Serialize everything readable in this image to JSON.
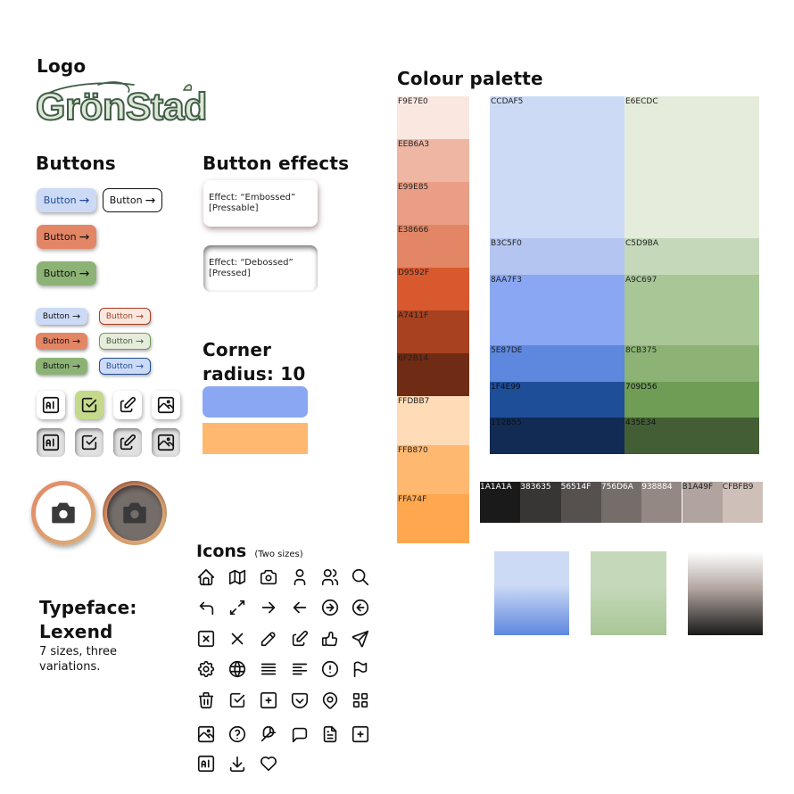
{
  "logo": {
    "heading": "Logo",
    "wordmark": "GrönStad"
  },
  "buttons": {
    "heading": "Buttons",
    "label": "Button",
    "arrow": "→"
  },
  "button_effects": {
    "heading": "Button effects",
    "embossed": {
      "line1": "Effect: “Embossed”",
      "line2": "[Pressable]"
    },
    "debossed": {
      "line1": "Effect: “Debossed”",
      "line2": "[Pressed]"
    }
  },
  "corner_radius": {
    "line1": "Corner",
    "line2": "radius: 10"
  },
  "typeface": {
    "line1": "Typeface:",
    "line2": "Lexend",
    "desc1": "7 sizes, three",
    "desc2": "variations."
  },
  "icons": {
    "heading": "Icons",
    "subheading": "(Two sizes)",
    "list": [
      "home-icon",
      "map-icon",
      "camera-icon",
      "user-icon",
      "users-icon",
      "search-icon",
      "arrow-back-up-icon",
      "arrows-diagonal-icon",
      "arrow-right-icon",
      "arrow-left-icon",
      "circle-arrow-right-icon",
      "circle-arrow-left-icon",
      "square-x-icon",
      "x-icon",
      "pencil-icon",
      "edit-icon",
      "thumb-up-icon",
      "send-icon",
      "settings-icon",
      "world-icon",
      "align-justified-icon",
      "align-left-icon",
      "alert-circle-icon",
      "flag-icon",
      "trash-icon",
      "square-check-icon",
      "square-plus-icon",
      "pocket-icon",
      "map-pin-icon",
      "layout-grid-icon",
      "photo-icon",
      "help-circle-icon",
      "feather-icon",
      "message-icon",
      "file-text-icon",
      "square-plus-icon",
      "ai-icon",
      "download-icon",
      "heart-icon"
    ]
  },
  "palette": {
    "heading": "Colour palette",
    "warm": [
      {
        "hex": "F9E7E0",
        "label": "F9E7E0"
      },
      {
        "hex": "EEB6A3",
        "label": "EEB6A3"
      },
      {
        "hex": "E99E85",
        "label": "E99E85"
      },
      {
        "hex": "E38666",
        "label": "E38666"
      },
      {
        "hex": "D9592F",
        "label": "D9592F"
      },
      {
        "hex": "A7411F",
        "label": "A7411F"
      },
      {
        "hex": "6F2B14",
        "label": "6F2B14"
      },
      {
        "hex": "FFDBB7",
        "label": "FFDBB7"
      },
      {
        "hex": "FFB870",
        "label": "FFB870"
      },
      {
        "hex": "FFA74F",
        "label": "FFA74F"
      }
    ],
    "blue": [
      {
        "hex": "CCDAF5",
        "label": "CCDAF5"
      },
      {
        "hex": "B3C5F0",
        "label": "B3C5F0"
      },
      {
        "hex": "8AA7F3",
        "label": "8AA7F3"
      },
      {
        "hex": "5E87DE",
        "label": "5E87DE"
      },
      {
        "hex": "1F4E99",
        "label": "1F4E99"
      },
      {
        "hex": "112B55",
        "label": "112B55"
      }
    ],
    "green": [
      {
        "hex": "E6ECDC",
        "label": "E6ECDC"
      },
      {
        "hex": "C5D9BA",
        "label": "C5D9BA"
      },
      {
        "hex": "A9C697",
        "label": "A9C697"
      },
      {
        "hex": "8CB375",
        "label": "8CB375"
      },
      {
        "hex": "709D56",
        "label": "709D56"
      },
      {
        "hex": "435E34",
        "label": "435E34"
      }
    ],
    "grays": [
      {
        "hex": "1A1A1A",
        "label": "1A1A1A"
      },
      {
        "hex": "383635",
        "label": "383635"
      },
      {
        "hex": "56514F",
        "label": "56514F"
      },
      {
        "hex": "756D6A",
        "label": "756D6A"
      },
      {
        "hex": "938884",
        "label": "938884"
      },
      {
        "hex": "B1A49F",
        "label": "B1A49F"
      },
      {
        "hex": "CFBFB9",
        "label": "CFBFB9"
      }
    ],
    "accent_blue": "#8AA7F3",
    "accent_orange": "#FFB870"
  }
}
